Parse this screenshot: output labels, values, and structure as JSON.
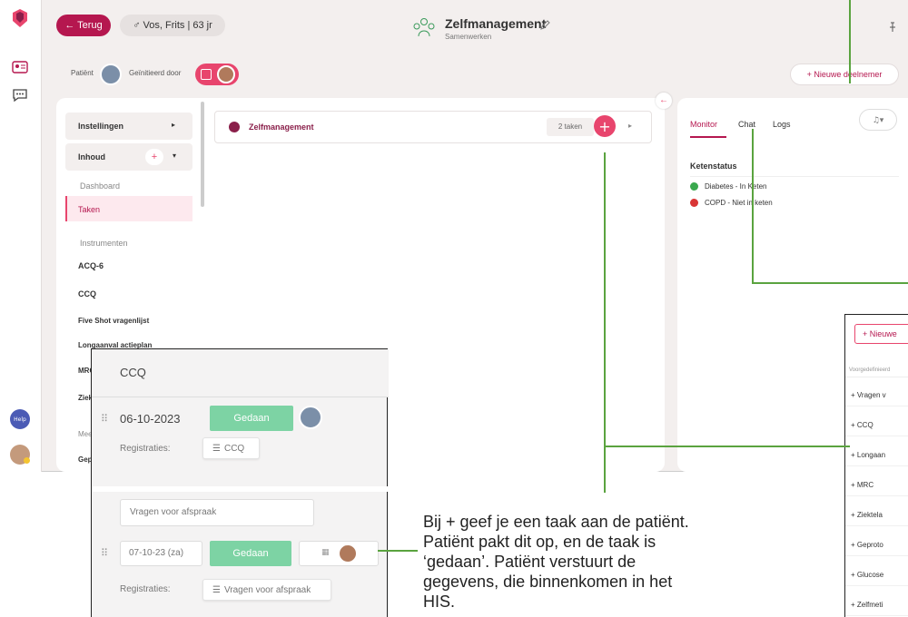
{
  "header": {
    "back_label": "← Terug",
    "patient_label": "♂ Vos, Frits | 63 jr",
    "title": "Zelfmanagement",
    "subtitle": "Samenwerken"
  },
  "participants": {
    "patient_label": "Patiënt",
    "invited_label": "Geïnitieerd door",
    "new_label": "+ Nieuwe deelnemer"
  },
  "sidebar": {
    "settings": "Instellingen",
    "content": "Inhoud",
    "dashboard": "Dashboard",
    "tasks": "Taken",
    "instruments": "Instrumenten",
    "acq": "ACQ-6",
    "ccq": "CCQ",
    "fiveshot": "Five Shot vragenlijst",
    "longaanval": "Longaanval actieplan",
    "mrc": "MRC",
    "ziekte": "Ziek",
    "meet": "Mee",
    "gep": "Gep"
  },
  "task": {
    "name": "Zelfmanagement",
    "count": "2 taken"
  },
  "monitor": {
    "tabs": [
      "Monitor",
      "Chat",
      "Logs"
    ],
    "chain_title": "Ketenstatus",
    "chains": [
      {
        "label": "Diabetes - In Keten",
        "color": "#3aa84e"
      },
      {
        "label": "COPD - Niet in keten",
        "color": "#d93535"
      }
    ]
  },
  "rightpanel": {
    "new_label": "+ Nieuwe",
    "predef_label": "Voorgedefinieerd",
    "items": [
      "+ Vragen v",
      "+ CCQ",
      "+ Longaan",
      "+ MRC",
      "+ Ziektela",
      "+ Geproto",
      "+ Glucose",
      "+ Zelfmeti"
    ]
  },
  "help_label": "Help",
  "overlay": {
    "title": "CCQ",
    "date1": "06-10-2023",
    "done1": "Gedaan",
    "reg_label1": "Registraties:",
    "reg_btn1": "CCQ",
    "question_placeholder": "Vragen voor afspraak",
    "date2": "07-10-23 (za)",
    "done2": "Gedaan",
    "reg_label2": "Registraties:",
    "reg_btn2": "Vragen voor afspraak"
  },
  "annotation": {
    "line1": "Bij + geef je een taak aan de patiënt.",
    "line2": "Patiënt pakt dit op, en de taak is",
    "line3": "‘gedaan’. Patiënt verstuurt de",
    "line4": "gegevens, die binnenkomen in het",
    "line5": "HIS."
  },
  "colors": {
    "brand": "#b5174f",
    "accent": "#e8456d",
    "done": "#7dd3a4",
    "annotation_line": "#5aa33f"
  }
}
